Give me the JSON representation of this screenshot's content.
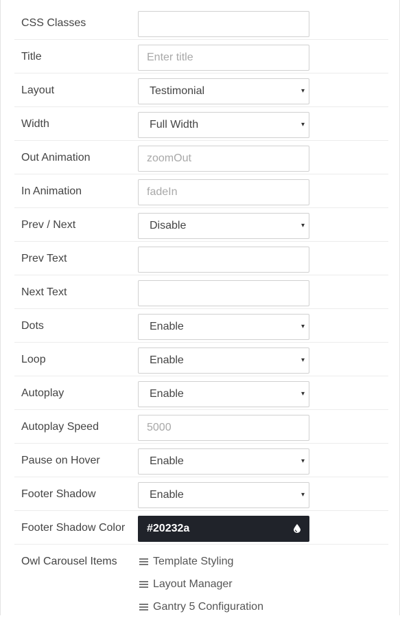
{
  "fields": {
    "css_classes": {
      "label": "CSS Classes",
      "value": ""
    },
    "title": {
      "label": "Title",
      "placeholder": "Enter title"
    },
    "layout": {
      "label": "Layout",
      "value": "Testimonial"
    },
    "width": {
      "label": "Width",
      "value": "Full Width"
    },
    "out_animation": {
      "label": "Out Animation",
      "placeholder": "zoomOut"
    },
    "in_animation": {
      "label": "In Animation",
      "placeholder": "fadeIn"
    },
    "prev_next": {
      "label": "Prev / Next",
      "value": "Disable"
    },
    "prev_text": {
      "label": "Prev Text",
      "value": ""
    },
    "next_text": {
      "label": "Next Text",
      "value": ""
    },
    "dots": {
      "label": "Dots",
      "value": "Enable"
    },
    "loop": {
      "label": "Loop",
      "value": "Enable"
    },
    "autoplay": {
      "label": "Autoplay",
      "value": "Enable"
    },
    "autoplay_speed": {
      "label": "Autoplay Speed",
      "placeholder": "5000"
    },
    "pause_on_hover": {
      "label": "Pause on Hover",
      "value": "Enable"
    },
    "footer_shadow": {
      "label": "Footer Shadow",
      "value": "Enable"
    },
    "footer_shadow_color": {
      "label": "Footer Shadow Color",
      "value": "#20232a",
      "color": "#20232a",
      "icon": "droplet-icon"
    }
  },
  "carousel": {
    "label": "Owl Carousel Items",
    "items": [
      {
        "label": "Template Styling",
        "icon": "drag-handle-icon"
      },
      {
        "label": "Layout Manager",
        "icon": "drag-handle-icon"
      },
      {
        "label": "Gantry 5 Configuration",
        "icon": "drag-handle-icon"
      }
    ]
  },
  "icons": {
    "caret": "▾"
  }
}
